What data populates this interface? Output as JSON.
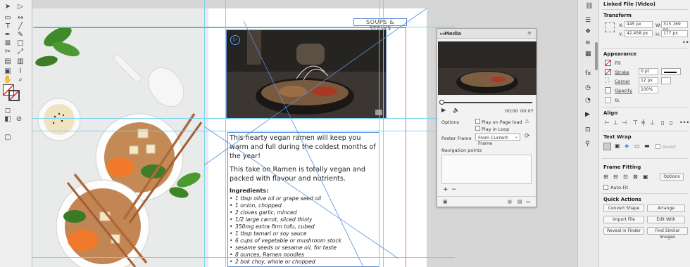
{
  "document": {
    "header_label": "SOUPS & STEWS",
    "paragraph1": "This hearty vegan ramen will keep you warm and full during the coldest months of the year!",
    "paragraph2": "This take on Ramen is totally vegan and packed with flavour and nutrients.",
    "ingredients_heading": "Ingredients:",
    "ingredients": [
      "1 tbsp olive oil or grape seed oil",
      "1 onion, chopped",
      "2 cloves garlic, minced",
      "1/2 large carrot, sliced thinly",
      "350mg extra firm tofu, cubed",
      "1 tbsp tamari or soy sauce",
      "6 cups of vegetable or mushroom stock",
      "sesame seeds or sesame oil, for taste",
      "8 ounces, Ramen noodles",
      "2 bok choy, whole or chopped"
    ]
  },
  "media_panel": {
    "title": "Media",
    "time_current": "00:00",
    "time_total": "00:07",
    "options_label": "Options",
    "play_on_load": "Play on Page load",
    "play_in_loop": "Play in Loop",
    "poster_frame_label": "Poster Frame",
    "poster_frame_value": "From Current Frame",
    "nav_points_label": "Navigation points",
    "add_symbol": "+",
    "remove_symbol": "−"
  },
  "properties": {
    "linked_file": "Linked File (Video)",
    "transform": {
      "title": "Transform",
      "x_label": "X:",
      "x_value": "445 px",
      "y_label": "Y:",
      "y_value": "42.458 px",
      "w_label": "W:",
      "w_value": "315.169 px",
      "h_label": "H:",
      "h_value": "177 px"
    },
    "appearance": {
      "title": "Appearance",
      "fill_label": "Fill",
      "stroke_label": "Stroke",
      "stroke_value": "0 pt",
      "corner_label": "Corner",
      "corner_value": "12 px",
      "opacity_label": "Opacity",
      "opacity_value": "100%",
      "fx_label": "fx."
    },
    "align": {
      "title": "Align"
    },
    "text_wrap": {
      "title": "Text Wrap",
      "invert_label": "Invert"
    },
    "frame_fitting": {
      "title": "Frame Fitting",
      "options_label": "Options",
      "auto_fit_label": "Auto-Fit"
    },
    "quick_actions": {
      "title": "Quick Actions",
      "convert_shape": "Convert Shape",
      "arrange": "Arrange",
      "import_file": "Import File",
      "edit_with": "Edit With",
      "reveal_in_finder": "Reveal in Finder",
      "find_similar": "Find Similar Images"
    }
  },
  "colors": {
    "guide": "#6fd1f0",
    "frame": "#5b8fd9",
    "margin": "#c964c9",
    "accent": "#2a6fd6"
  }
}
